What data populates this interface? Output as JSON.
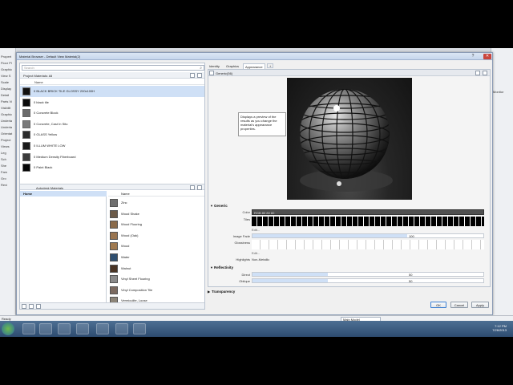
{
  "app_left_items": [
    "Propert",
    "Floor Pl",
    "Graphic",
    "View S",
    "Scale",
    "Display",
    "Detail",
    "Parts Vi",
    "Visibilit",
    "Graphic",
    "Underla",
    "Underla",
    "Orientat",
    "Project",
    "Views",
    "Leg",
    "Sch",
    "She",
    "Fam",
    "Gro",
    "Revi"
  ],
  "app_right_label": "Monitor",
  "dialog": {
    "title": "Material Browser - Default View Material(2)",
    "search_placeholder": "Search",
    "project_bar_label": "Project Materials: All",
    "name_column": "Name",
    "project_materials": [
      {
        "name": "0 BLACK BRICK TILE GLOSSY 200x100H",
        "color": "#111111",
        "selected": true
      },
      {
        "name": "0 black tile",
        "color": "#0a0a0a",
        "selected": false
      },
      {
        "name": "0 Concrete Block",
        "color": "#6b6b6b",
        "selected": false
      },
      {
        "name": "0 Concrete, Cast In Situ",
        "color": "#7a7a7a",
        "selected": false
      },
      {
        "name": "0 GLASS Yellow",
        "color": "#2b2b2b",
        "selected": false
      },
      {
        "name": "0 ILLUM WHITE LOW",
        "color": "#1a1a1a",
        "selected": false
      },
      {
        "name": "0 Medium Density Fiberboard",
        "color": "#3b3b3b",
        "selected": false
      },
      {
        "name": "0 Paint Black",
        "color": "#050505",
        "selected": false
      }
    ],
    "library_bar_label": "Autodesk Materials",
    "library_home": "Home",
    "library_materials": [
      {
        "name": "Zinc",
        "color": "#707070"
      },
      {
        "name": "Wood Shake",
        "color": "#6b5a48"
      },
      {
        "name": "Wood Flooring",
        "color": "#8a6a4a"
      },
      {
        "name": "Wood (Oak)",
        "color": "#9a7550"
      },
      {
        "name": "Wood",
        "color": "#a07a50"
      },
      {
        "name": "Water",
        "color": "#2f4f70"
      },
      {
        "name": "Walnut",
        "color": "#4a3424"
      },
      {
        "name": "Vinyl Sheet Flooring",
        "color": "#8a8a8a"
      },
      {
        "name": "Vinyl Composition Tile",
        "color": "#7b6a60"
      },
      {
        "name": "Vermiculite, Loose",
        "color": "#8c8478"
      }
    ],
    "tabs": [
      "Identity",
      "Graphics",
      "Appearance",
      "+"
    ],
    "active_tab": "Appearance",
    "asset_name": "Generic(56)",
    "tooltip": "Displays a preview of the results as you change the material's appearance properties.",
    "generic_section": "Generic",
    "color_label": "Color",
    "color_value": "RGB 80 80 80",
    "image_label": "Tiles",
    "edit_label": "Edit...",
    "image_fade_label": "Image Fade",
    "image_fade_value": "100",
    "image_fade_level": 1.0,
    "glossiness_label": "Glossiness",
    "highlights_label": "Highlights",
    "highlights_value": "Non-Metallic",
    "reflectivity_section": "Reflectivity",
    "direct_label": "Direct",
    "direct_value": "50",
    "direct_level": 0.5,
    "oblique_label": "Oblique",
    "oblique_value": "50",
    "oblique_level": 0.5,
    "transparency_section": "Transparency",
    "ok_label": "OK",
    "cancel_label": "Cancel",
    "apply_label": "Apply"
  },
  "status": {
    "text": "Ready",
    "model": "Main Model"
  },
  "clock": {
    "time": "7:12 PM",
    "date": "7/26/2013"
  }
}
